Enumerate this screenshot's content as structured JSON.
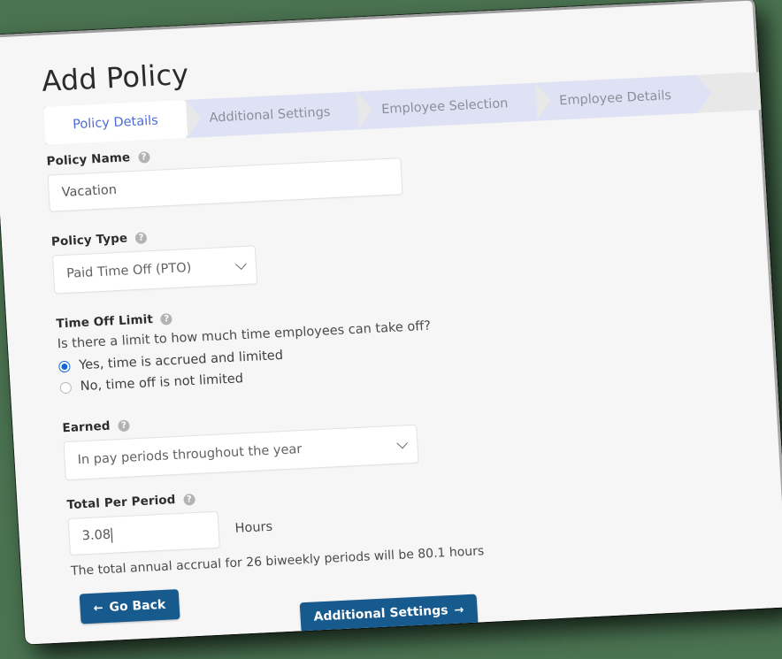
{
  "page": {
    "title": "Add Policy",
    "background_color": "#4a7351",
    "accent_color": "#175a8e",
    "tab_active_color": "#4b6cd6"
  },
  "wizard": {
    "tabs": [
      {
        "label": "Policy Details",
        "state": "active"
      },
      {
        "label": "Additional Settings",
        "state": "upcoming"
      },
      {
        "label": "Employee Selection",
        "state": "upcoming"
      },
      {
        "label": "Employee Details",
        "state": "upcoming"
      }
    ]
  },
  "form": {
    "policy_name": {
      "label": "Policy Name",
      "help": "?",
      "value": "Vacation",
      "placeholder": "Policy Name"
    },
    "policy_type": {
      "label": "Policy Type",
      "help": "?",
      "value": "Paid Time Off (PTO)"
    },
    "time_off_limit": {
      "label": "Time Off Limit",
      "help": "?",
      "question": "Is there a limit to how much time employees can take off?",
      "options": [
        {
          "label": "Yes, time is accrued and limited",
          "selected": true
        },
        {
          "label": "No, time off is not limited",
          "selected": false
        }
      ]
    },
    "earned": {
      "label": "Earned",
      "help": "?",
      "value": "In pay periods throughout the year"
    },
    "total_per_period": {
      "label": "Total Per Period",
      "help": "?",
      "value": "3.08",
      "unit": "Hours",
      "helper_text": "The total annual accrual for 26 biweekly periods will be 80.1 hours"
    }
  },
  "actions": {
    "back": {
      "label": "Go Back",
      "icon": "arrow-left"
    },
    "next": {
      "label": "Additional Settings",
      "icon": "arrow-right"
    }
  },
  "icons": {
    "arrow_left": "←",
    "arrow_right": "→"
  }
}
